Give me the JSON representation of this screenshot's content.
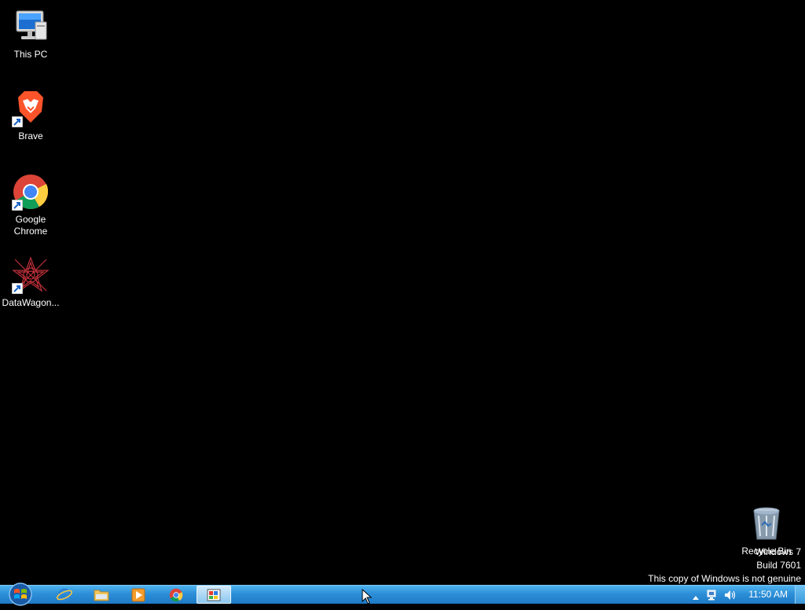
{
  "desktop": {
    "icons": [
      {
        "label": "This PC",
        "icon": "computer-icon"
      },
      {
        "label": "Brave",
        "icon": "brave-icon"
      },
      {
        "label": "Google Chrome",
        "icon": "chrome-icon"
      },
      {
        "label": "DataWagon...",
        "icon": "datawagon-icon"
      },
      {
        "label": "Recycle Bin",
        "icon": "recycle-bin-icon"
      }
    ],
    "watermark": {
      "line1": "Windows 7",
      "line2": "Build 7601",
      "line3": "This copy of Windows is not genuine"
    }
  },
  "taskbar": {
    "pinned": [
      {
        "name": "internet-explorer",
        "icon": "internet-explorer-icon"
      },
      {
        "name": "file-explorer",
        "icon": "folder-icon"
      },
      {
        "name": "media-player",
        "icon": "media-player-icon"
      },
      {
        "name": "chrome",
        "icon": "chrome-icon"
      },
      {
        "name": "paint",
        "icon": "paint-icon",
        "active": true
      }
    ],
    "clock": "11:50 AM"
  }
}
